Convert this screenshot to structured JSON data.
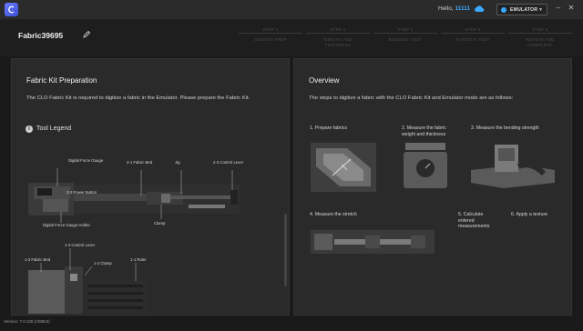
{
  "header": {
    "greeting": "Hello,",
    "username": "11111",
    "mode": "EMULATOR"
  },
  "title": {
    "fabric_name": "Fabric39695"
  },
  "steps": [
    {
      "num": "STEP 1",
      "name": "SWATCH PREP"
    },
    {
      "num": "STEP 2",
      "name": "WEIGHT AND\nTHICKNESS"
    },
    {
      "num": "STEP 3",
      "name": "BENDING TEST"
    },
    {
      "num": "STEP 4",
      "name": "STRETCH TEST"
    },
    {
      "num": "STEP 5",
      "name": "REVIEW AND\nCOMPLETE"
    }
  ],
  "left_panel": {
    "title": "Fabric Kit Preparation",
    "description": "The CLO Fabric Kit is required to digitize a fabric in the Emulator. Please prepare the Fabric Kit.",
    "legend_title": "Tool Legend",
    "labels": {
      "force_gauge": "Digital Force Gauge",
      "fabric_bed": "2-1 Fabric Bed",
      "jig": "Jig",
      "control_lever": "2-3 Control Lever",
      "power_button": "2-2 Power Button",
      "clamp": "Clamp",
      "gauge_holder": "Digital Force Gauge Holder",
      "control_lever2": "1-4 Control Lever",
      "fabric_bed2": "1-3 Fabric Bed",
      "clamp2": "1-2 Clamp",
      "ruler": "1-1 Ruler"
    }
  },
  "right_panel": {
    "title": "Overview",
    "description": "The steps to digitize a fabric with the CLO Fabric Kit and Emulator mode are as follows:",
    "steps": [
      "1. Prepare fabrics",
      "2. Measure the fabric\nweight and thickness",
      "3. Measure the bending strength",
      "4. Measure the stretch",
      "5. Calculate\nentered\nmeasurements",
      "6. Apply a texture"
    ]
  },
  "footer": {
    "version": "Version: 7.0.228 (r39853)"
  }
}
